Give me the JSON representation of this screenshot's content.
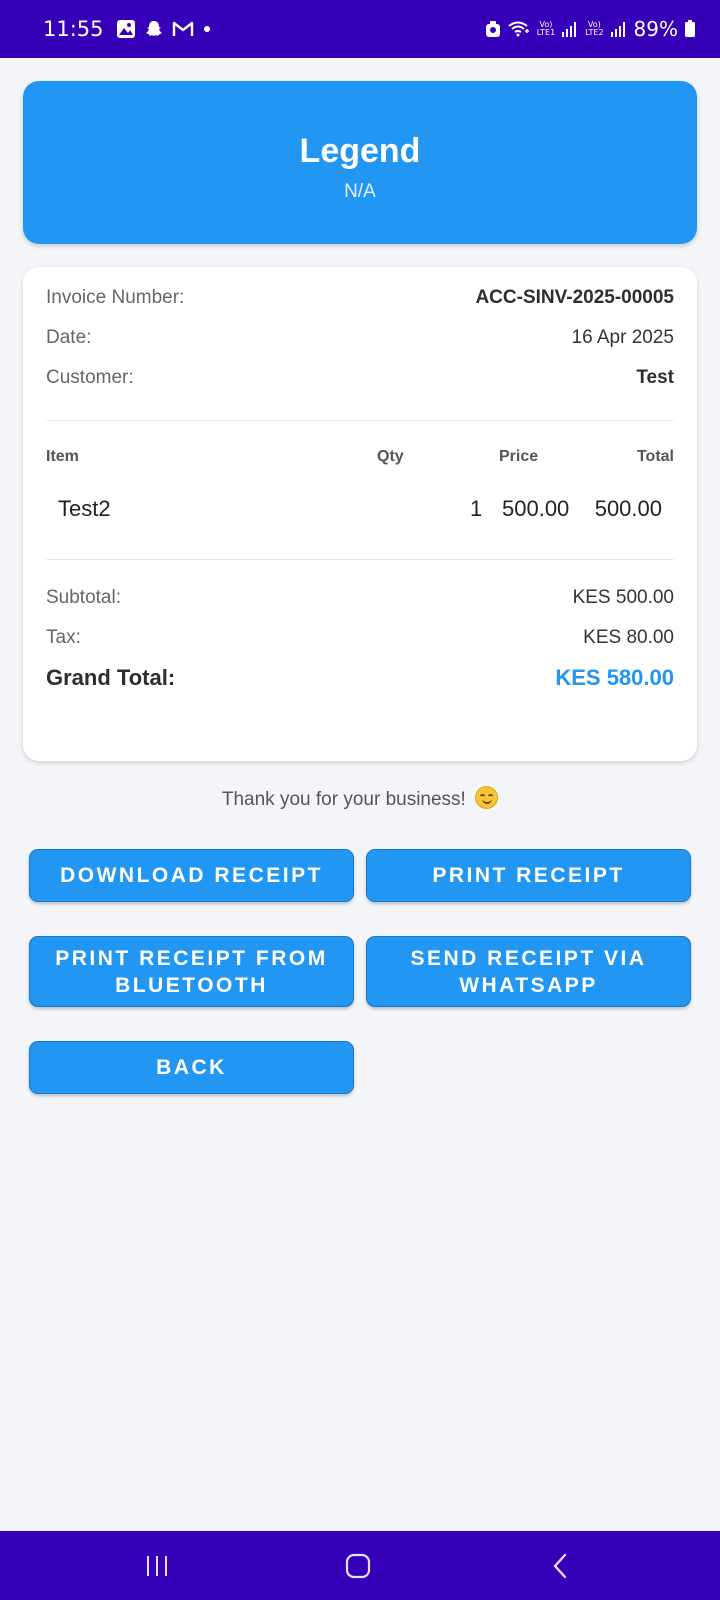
{
  "status_bar": {
    "time": "11:55",
    "lte1": "LTE1",
    "lte2": "LTE2",
    "battery": "89%",
    "icons": [
      "gallery-icon",
      "snapchat-icon",
      "gmail-icon",
      "dot-icon",
      "alarm-icon",
      "wifi-icon",
      "signal-icon",
      "signal-icon",
      "battery-icon"
    ]
  },
  "header": {
    "title": "Legend",
    "subtitle": "N/A"
  },
  "invoice": {
    "invoice_number_label": "Invoice Number:",
    "invoice_number": "ACC-SINV-2025-00005",
    "date_label": "Date:",
    "date": "16 Apr 2025",
    "customer_label": "Customer:",
    "customer": "Test",
    "columns": {
      "item": "Item",
      "qty": "Qty",
      "price": "Price",
      "total": "Total"
    },
    "items": [
      {
        "item": "Test2",
        "qty": "1",
        "price": "500.00",
        "total": "500.00"
      }
    ],
    "subtotal_label": "Subtotal:",
    "subtotal": "KES 500.00",
    "tax_label": "Tax:",
    "tax": "KES 80.00",
    "grand_total_label": "Grand Total:",
    "grand_total": "KES 580.00"
  },
  "thanks_message": "Thank you for your business!",
  "buttons": {
    "download": "DOWNLOAD RECEIPT",
    "print": "PRINT RECEIPT",
    "print_bluetooth": "PRINT RECEIPT FROM BLUETOOTH",
    "whatsapp": "SEND RECEIPT VIA WHATSAPP",
    "back": "BACK"
  },
  "colors": {
    "system_bar": "#3600b8",
    "accent": "#2196f3",
    "background": "#f4f5f9"
  }
}
